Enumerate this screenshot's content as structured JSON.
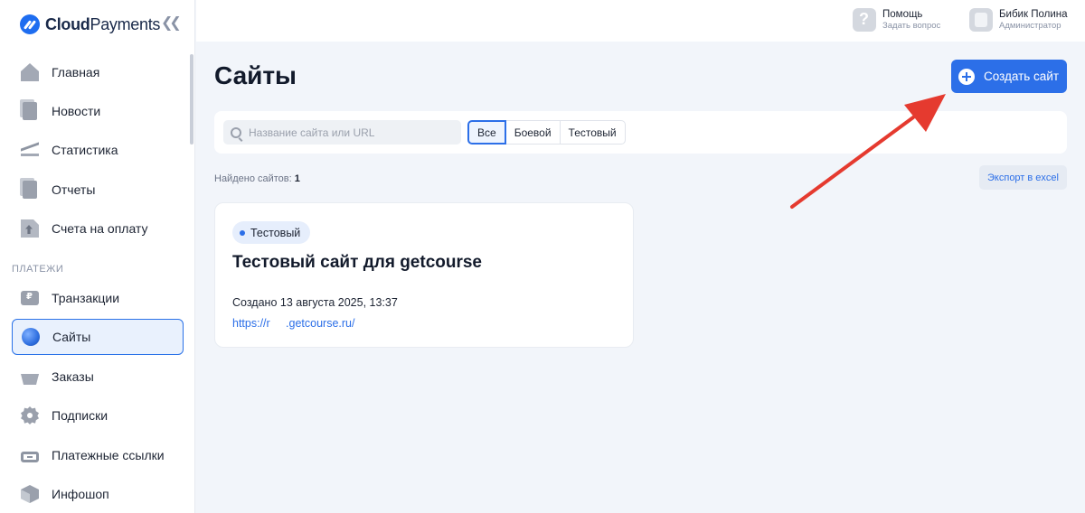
{
  "app": {
    "logo_text_bold": "Cloud",
    "logo_text_regular": "Payments",
    "collapse_icon": "double-chevron-left-icon"
  },
  "sidebar": {
    "items": [
      {
        "label": "Главная",
        "icon": "home-icon"
      },
      {
        "label": "Новости",
        "icon": "news-icon"
      },
      {
        "label": "Статистика",
        "icon": "chart-icon"
      },
      {
        "label": "Отчеты",
        "icon": "reports-icon"
      },
      {
        "label": "Счета на оплату",
        "icon": "invoice-icon"
      }
    ],
    "section_label": "ПЛАТЕЖИ",
    "payment_items": [
      {
        "label": "Транзакции",
        "icon": "cash-icon"
      },
      {
        "label": "Сайты",
        "icon": "globe-icon",
        "active": true
      },
      {
        "label": "Заказы",
        "icon": "basket-icon"
      },
      {
        "label": "Подписки",
        "icon": "gear-icon"
      },
      {
        "label": "Платежные ссылки",
        "icon": "link-icon"
      },
      {
        "label": "Инфошоп",
        "icon": "box-icon"
      }
    ]
  },
  "header": {
    "help_title": "Помощь",
    "help_sub": "Задать вопрос",
    "user_name": "Бибик Полина",
    "user_role": "Администратор"
  },
  "main": {
    "title": "Сайты",
    "create_label": "Создать сайт",
    "search_placeholder": "Название сайта или URL",
    "filters": [
      "Все",
      "Боевой",
      "Тестовый"
    ],
    "active_filter": "Все",
    "found_label": "Найдено сайтов:",
    "found_count": "1",
    "export_label": "Экспорт в excel"
  },
  "site_card": {
    "badge": "Тестовый",
    "title": "Тестовый сайт для getcourse",
    "created": "Создано 13 августа 2025, 13:37",
    "url": "https://r     .getcourse.ru/"
  },
  "colors": {
    "accent": "#2c6fe8",
    "annotation_arrow": "#e53a2f",
    "background": "#f2f5fa"
  }
}
